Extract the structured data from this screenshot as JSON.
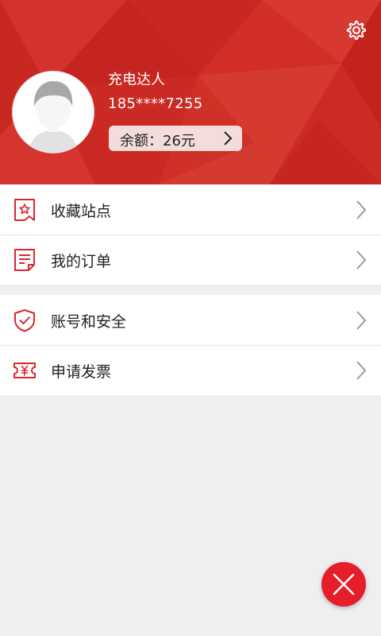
{
  "profile": {
    "name": "充电达人",
    "phone": "185****7255",
    "balance_label": "余额：26元"
  },
  "menu_group_1": [
    {
      "label": "收藏站点",
      "icon": "bookmark-star-icon"
    },
    {
      "label": "我的订单",
      "icon": "order-list-icon"
    }
  ],
  "menu_group_2": [
    {
      "label": "账号和安全",
      "icon": "shield-check-icon"
    },
    {
      "label": "申请发票",
      "icon": "invoice-ticket-icon"
    }
  ],
  "colors": {
    "header_red": "#cd2a24",
    "accent_red": "#d8282f",
    "fab_red": "#e51e2a"
  }
}
